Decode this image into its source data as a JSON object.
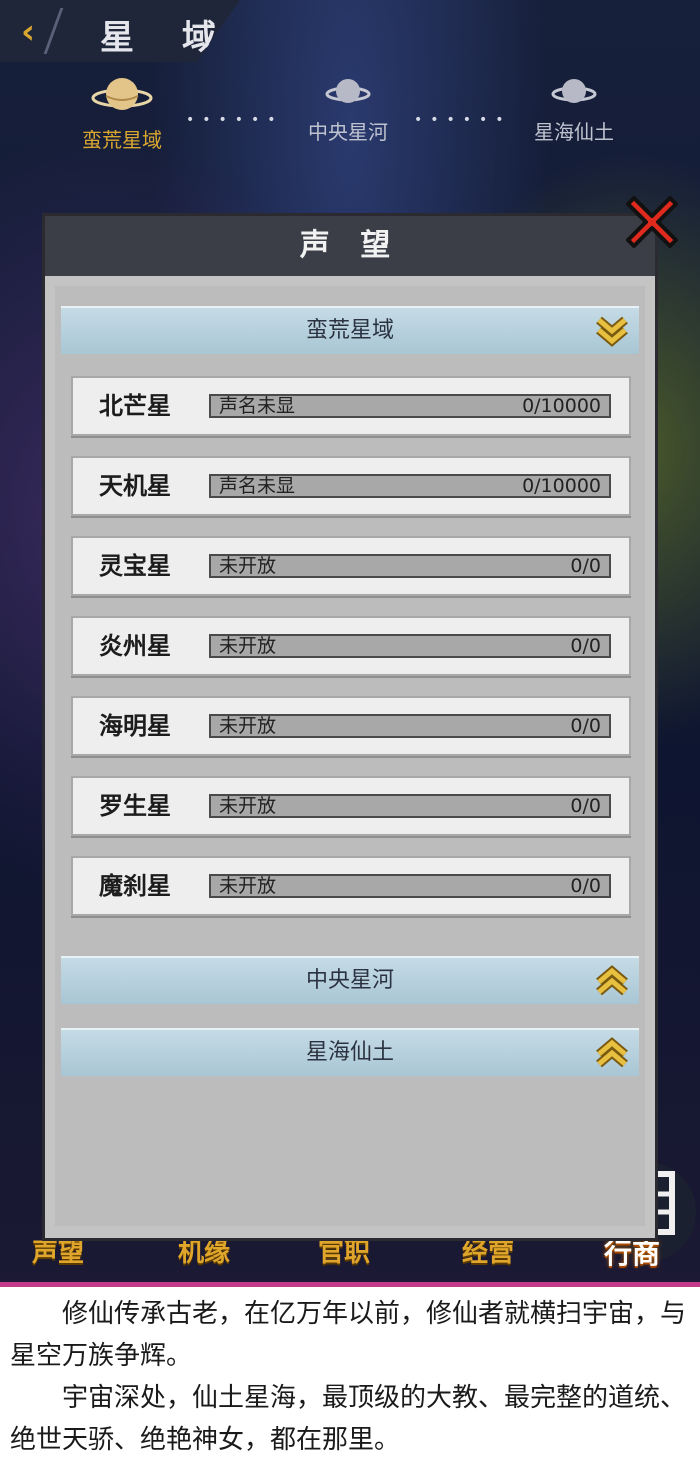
{
  "header": {
    "title": "星 域",
    "back_icon": "chevron-left-icon"
  },
  "region_nav": {
    "regions": [
      {
        "label": "蛮荒星域",
        "active": true
      },
      {
        "label": "中央星河",
        "active": false
      },
      {
        "label": "星海仙土",
        "active": false
      }
    ],
    "dots": "••••••",
    "active_color": "#d9a630",
    "inactive_color": "#bfc3cf"
  },
  "dialog": {
    "title": "声 望",
    "close_icon": "close-x-icon",
    "groups": [
      {
        "title": "蛮荒星域",
        "expanded": true,
        "rows": [
          {
            "name": "北芒星",
            "status": "声名未显",
            "value": "0/10000",
            "progress": 0
          },
          {
            "name": "天机星",
            "status": "声名未显",
            "value": "0/10000",
            "progress": 0
          },
          {
            "name": "灵宝星",
            "status": "未开放",
            "value": "0/0",
            "progress": 0
          },
          {
            "name": "炎州星",
            "status": "未开放",
            "value": "0/0",
            "progress": 0
          },
          {
            "name": "海明星",
            "status": "未开放",
            "value": "0/0",
            "progress": 0
          },
          {
            "name": "罗生星",
            "status": "未开放",
            "value": "0/0",
            "progress": 0
          },
          {
            "name": "魔刹星",
            "status": "未开放",
            "value": "0/0",
            "progress": 0
          }
        ]
      },
      {
        "title": "中央星河",
        "expanded": false
      },
      {
        "title": "星海仙土",
        "expanded": false
      }
    ]
  },
  "bottom_tabs": {
    "labels": [
      "声望",
      "机缘",
      "官职",
      "经营"
    ],
    "merchant": "行商",
    "accent": "#e0a62c"
  },
  "caption": {
    "paragraphs": [
      "修仙传承古老，在亿万年以前，修仙者就横扫宇宙，与星空万族争辉。",
      "宇宙深处，仙土星海，最顶级的大教、最完整的道统、绝世天骄、绝艳神女，都在那里。"
    ]
  }
}
